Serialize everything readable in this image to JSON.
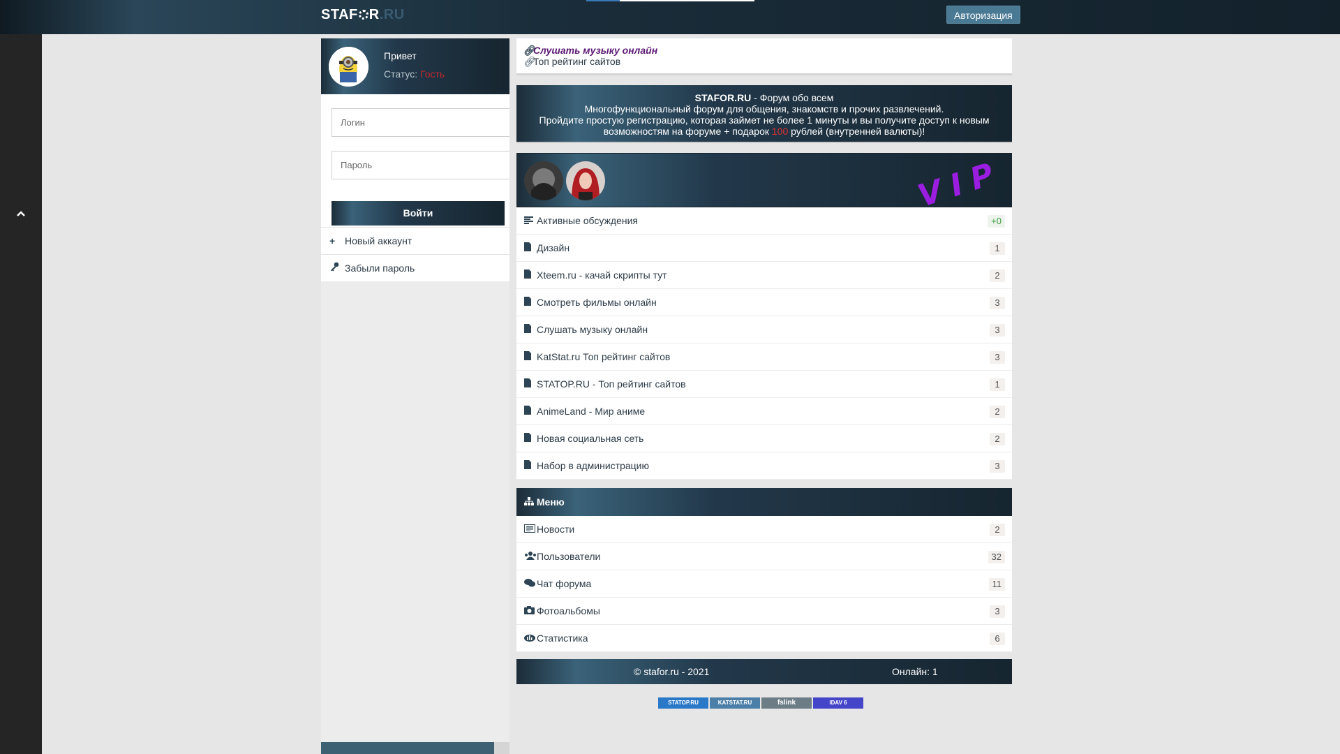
{
  "topbar": {
    "logo_main": "STAF",
    "logo_mid": "R",
    "logo_ru": ".RU",
    "auth_label": "Авторизация"
  },
  "sidebar": {
    "hello": "Привет",
    "status_label": "Статус:",
    "status_value": "Гость",
    "login_placeholder": "Логин",
    "password_placeholder": "Пароль",
    "login_button": "Войти",
    "links": [
      {
        "icon": "plus-icon",
        "label": "Новый аккаунт"
      },
      {
        "icon": "key-icon",
        "label": "Забыли пароль"
      }
    ]
  },
  "links_box": {
    "link1": "Слушать музыку онлайн",
    "link2": "Топ рейтинг сайтов"
  },
  "banner": {
    "title": "STAFOR.RU",
    "title_rest": " - Форум обо всем",
    "line2": "Многофункциональный форум для общения, знакомств и прочих развлечений.",
    "line3": "Пройдите простую регистрацию, которая займет не более 1 минуты и вы получите доступ к новым",
    "line4_a": "возможностям на форуме + подарок ",
    "line4_num": "100",
    "line4_b": " рублей (внутренней валюты)!"
  },
  "vip": {
    "label": "VIP"
  },
  "forum": {
    "active": {
      "label": "Активные обсуждения",
      "count": "+0"
    },
    "items": [
      {
        "label": "Дизайн",
        "count": "1"
      },
      {
        "label": "Xteem.ru - качай скрипты тут",
        "count": "2"
      },
      {
        "label": "Смотреть фильмы онлайн",
        "count": "3"
      },
      {
        "label": "Слушать музыку онлайн",
        "count": "3"
      },
      {
        "label": "KatStat.ru Топ рейтинг сайтов",
        "count": "3"
      },
      {
        "label": "STATOP.RU - Топ рейтинг сайтов",
        "count": "1"
      },
      {
        "label": "AnimeLand - Мир аниме",
        "count": "2"
      },
      {
        "label": "Новая социальная сеть",
        "count": "2"
      },
      {
        "label": "Набор в администрацию",
        "count": "3"
      }
    ]
  },
  "menu": {
    "title": "Меню",
    "items": [
      {
        "icon": "news-icon",
        "label": "Новости",
        "count": "2"
      },
      {
        "icon": "users-icon",
        "label": "Пользователи",
        "count": "32"
      },
      {
        "icon": "chat-icon",
        "label": "Чат форума",
        "count": "11"
      },
      {
        "icon": "camera-icon",
        "label": "Фотоальбомы",
        "count": "3"
      },
      {
        "icon": "stats-icon",
        "label": "Статистика",
        "count": "6"
      }
    ]
  },
  "footer": {
    "copyright": "© stafor.ru - 2021",
    "online": "Онлайн: 1"
  },
  "counters": [
    "STATOP.RU",
    "KATSTAT.RU",
    "fslink",
    "IDAV 6"
  ]
}
